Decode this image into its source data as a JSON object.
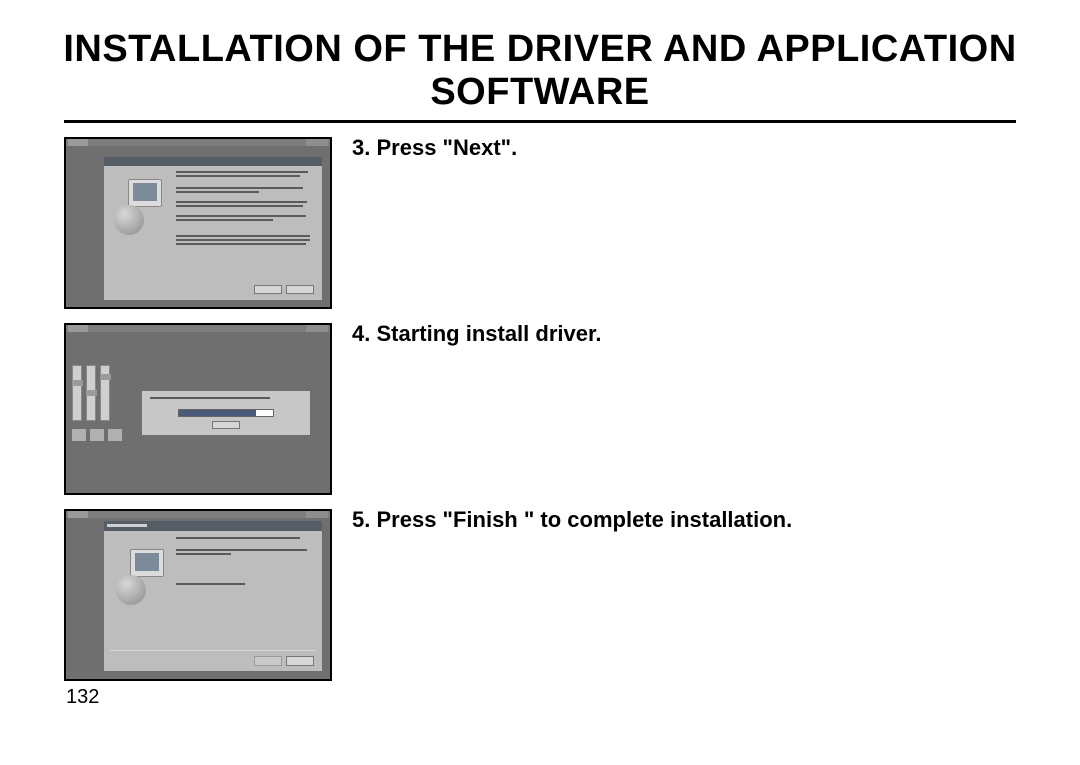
{
  "title": "INSTALLATION OF THE DRIVER AND APPLICATION SOFTWARE",
  "steps": [
    {
      "num": "3.",
      "text": "Press \"Next\"."
    },
    {
      "num": "4.",
      "text": "Starting install driver."
    },
    {
      "num": "5.",
      "text": "Press \"Finish \" to complete installation."
    }
  ],
  "page_number": "132"
}
